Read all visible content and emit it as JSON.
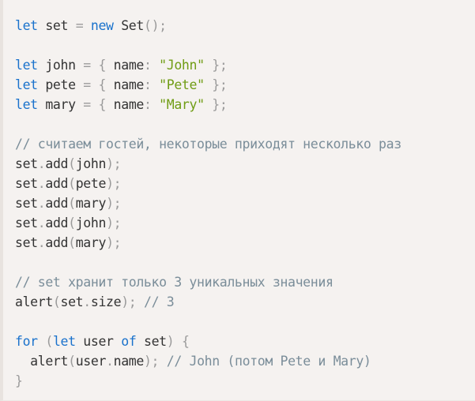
{
  "code": {
    "lines": [
      [
        {
          "t": "let",
          "c": "kw"
        },
        {
          "t": " set ",
          "c": "pl"
        },
        {
          "t": "=",
          "c": "pun"
        },
        {
          "t": " ",
          "c": "pl"
        },
        {
          "t": "new",
          "c": "kw"
        },
        {
          "t": " Set",
          "c": "pl"
        },
        {
          "t": "();",
          "c": "pun"
        }
      ],
      [],
      [
        {
          "t": "let",
          "c": "kw"
        },
        {
          "t": " john ",
          "c": "pl"
        },
        {
          "t": "=",
          "c": "pun"
        },
        {
          "t": " ",
          "c": "pl"
        },
        {
          "t": "{",
          "c": "pun"
        },
        {
          "t": " name",
          "c": "pl"
        },
        {
          "t": ":",
          "c": "pun"
        },
        {
          "t": " ",
          "c": "pl"
        },
        {
          "t": "\"John\"",
          "c": "str"
        },
        {
          "t": " ",
          "c": "pl"
        },
        {
          "t": "};",
          "c": "pun"
        }
      ],
      [
        {
          "t": "let",
          "c": "kw"
        },
        {
          "t": " pete ",
          "c": "pl"
        },
        {
          "t": "=",
          "c": "pun"
        },
        {
          "t": " ",
          "c": "pl"
        },
        {
          "t": "{",
          "c": "pun"
        },
        {
          "t": " name",
          "c": "pl"
        },
        {
          "t": ":",
          "c": "pun"
        },
        {
          "t": " ",
          "c": "pl"
        },
        {
          "t": "\"Pete\"",
          "c": "str"
        },
        {
          "t": " ",
          "c": "pl"
        },
        {
          "t": "};",
          "c": "pun"
        }
      ],
      [
        {
          "t": "let",
          "c": "kw"
        },
        {
          "t": " mary ",
          "c": "pl"
        },
        {
          "t": "=",
          "c": "pun"
        },
        {
          "t": " ",
          "c": "pl"
        },
        {
          "t": "{",
          "c": "pun"
        },
        {
          "t": " name",
          "c": "pl"
        },
        {
          "t": ":",
          "c": "pun"
        },
        {
          "t": " ",
          "c": "pl"
        },
        {
          "t": "\"Mary\"",
          "c": "str"
        },
        {
          "t": " ",
          "c": "pl"
        },
        {
          "t": "};",
          "c": "pun"
        }
      ],
      [],
      [
        {
          "t": "// считаем гостей, некоторые приходят несколько раз",
          "c": "cm"
        }
      ],
      [
        {
          "t": "set",
          "c": "pl"
        },
        {
          "t": ".",
          "c": "pun"
        },
        {
          "t": "add",
          "c": "pl"
        },
        {
          "t": "(",
          "c": "pun"
        },
        {
          "t": "john",
          "c": "pl"
        },
        {
          "t": ");",
          "c": "pun"
        }
      ],
      [
        {
          "t": "set",
          "c": "pl"
        },
        {
          "t": ".",
          "c": "pun"
        },
        {
          "t": "add",
          "c": "pl"
        },
        {
          "t": "(",
          "c": "pun"
        },
        {
          "t": "pete",
          "c": "pl"
        },
        {
          "t": ");",
          "c": "pun"
        }
      ],
      [
        {
          "t": "set",
          "c": "pl"
        },
        {
          "t": ".",
          "c": "pun"
        },
        {
          "t": "add",
          "c": "pl"
        },
        {
          "t": "(",
          "c": "pun"
        },
        {
          "t": "mary",
          "c": "pl"
        },
        {
          "t": ");",
          "c": "pun"
        }
      ],
      [
        {
          "t": "set",
          "c": "pl"
        },
        {
          "t": ".",
          "c": "pun"
        },
        {
          "t": "add",
          "c": "pl"
        },
        {
          "t": "(",
          "c": "pun"
        },
        {
          "t": "john",
          "c": "pl"
        },
        {
          "t": ");",
          "c": "pun"
        }
      ],
      [
        {
          "t": "set",
          "c": "pl"
        },
        {
          "t": ".",
          "c": "pun"
        },
        {
          "t": "add",
          "c": "pl"
        },
        {
          "t": "(",
          "c": "pun"
        },
        {
          "t": "mary",
          "c": "pl"
        },
        {
          "t": ");",
          "c": "pun"
        }
      ],
      [],
      [
        {
          "t": "// set хранит только 3 уникальных значения",
          "c": "cm"
        }
      ],
      [
        {
          "t": "alert",
          "c": "pl"
        },
        {
          "t": "(",
          "c": "pun"
        },
        {
          "t": "set",
          "c": "pl"
        },
        {
          "t": ".",
          "c": "pun"
        },
        {
          "t": "size",
          "c": "pl"
        },
        {
          "t": ");",
          "c": "pun"
        },
        {
          "t": " ",
          "c": "pl"
        },
        {
          "t": "// 3",
          "c": "cm"
        }
      ],
      [],
      [
        {
          "t": "for",
          "c": "kw"
        },
        {
          "t": " ",
          "c": "pl"
        },
        {
          "t": "(",
          "c": "pun"
        },
        {
          "t": "let",
          "c": "kw"
        },
        {
          "t": " user ",
          "c": "pl"
        },
        {
          "t": "of",
          "c": "kw"
        },
        {
          "t": " set",
          "c": "pl"
        },
        {
          "t": ")",
          "c": "pun"
        },
        {
          "t": " ",
          "c": "pl"
        },
        {
          "t": "{",
          "c": "pun"
        }
      ],
      [
        {
          "t": "  alert",
          "c": "pl"
        },
        {
          "t": "(",
          "c": "pun"
        },
        {
          "t": "user",
          "c": "pl"
        },
        {
          "t": ".",
          "c": "pun"
        },
        {
          "t": "name",
          "c": "pl"
        },
        {
          "t": ");",
          "c": "pun"
        },
        {
          "t": " ",
          "c": "pl"
        },
        {
          "t": "// John (потом Pete и Mary)",
          "c": "cm"
        }
      ],
      [
        {
          "t": "}",
          "c": "pun"
        }
      ]
    ]
  },
  "colors": {
    "background": "#f5f2f0",
    "keyword": "#1a72cc",
    "string": "#6f9c13",
    "punctuation": "#9b9b9b",
    "comment": "#7a8d99",
    "text": "#333333"
  }
}
